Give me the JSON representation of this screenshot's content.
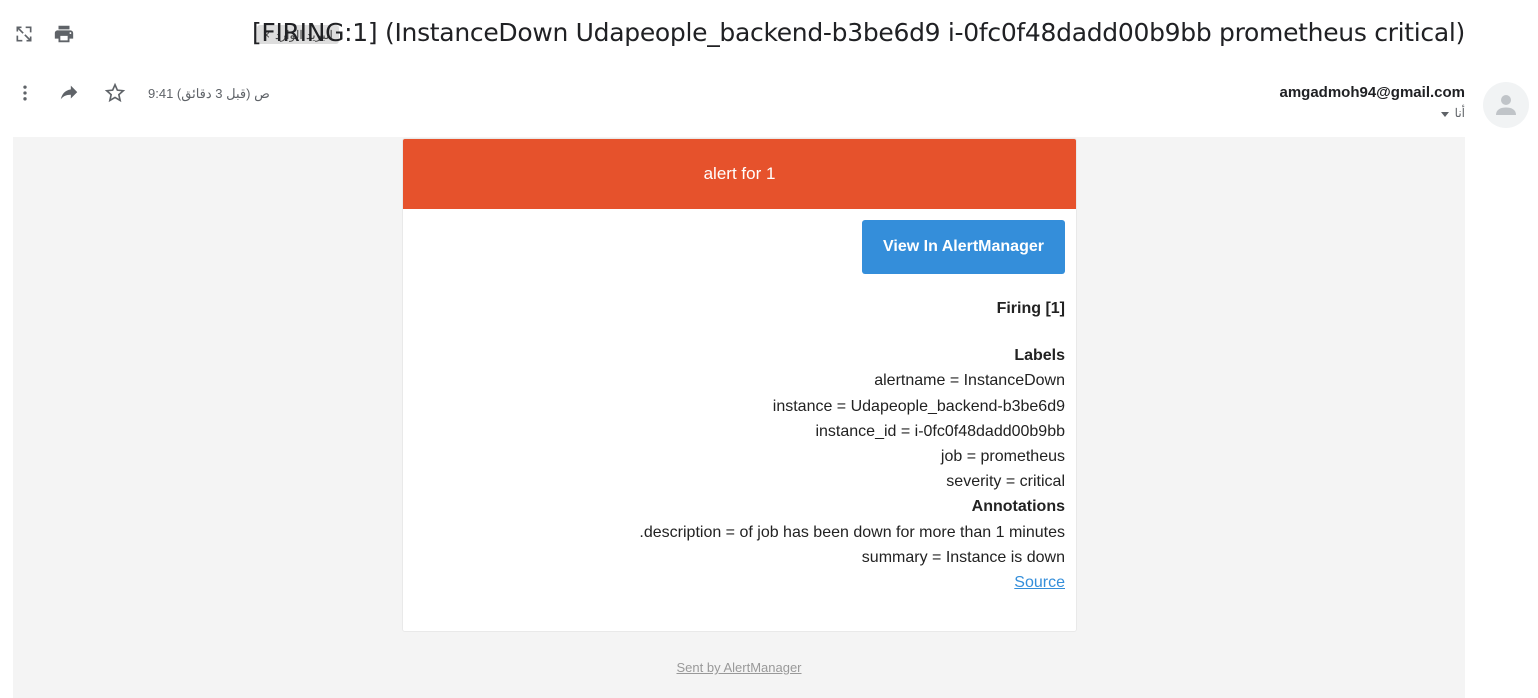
{
  "header": {
    "subject": "[FIRING:1] (InstanceDown Udapeople_backend-b3be6d9 i-0fc0f48dadd00b9bb prometheus critical)",
    "inbox_label": "البريد الوارد",
    "remove_label": "×"
  },
  "toolbar": {
    "open_new_window_icon": "open-in-new-icon",
    "print_icon": "print-icon",
    "more_icon": "more-vert-icon",
    "forward_icon": "forward-icon",
    "star_icon": "star-icon"
  },
  "message": {
    "sender": "amgadmoh94@gmail.com",
    "to": "أنا",
    "time": "9:41 ص (قبل 3 دقائق)"
  },
  "email": {
    "header_title": "alert for 1",
    "header_color": "#e6522c",
    "button_label": "View In AlertManager",
    "button_color": "#348eda",
    "firing": "Firing [1]",
    "labels_heading": "Labels",
    "labels": [
      "alertname = InstanceDown",
      "instance = Udapeople_backend-b3be6d9",
      "instance_id = i-0fc0f48dadd00b9bb",
      "job = prometheus",
      "severity = critical"
    ],
    "annotations_heading": "Annotations",
    "annotations": [
      "description = of job has been down for more than 1 minutes.",
      "summary = Instance is down"
    ],
    "source_link": "Source",
    "footer": "Sent by AlertManager"
  }
}
